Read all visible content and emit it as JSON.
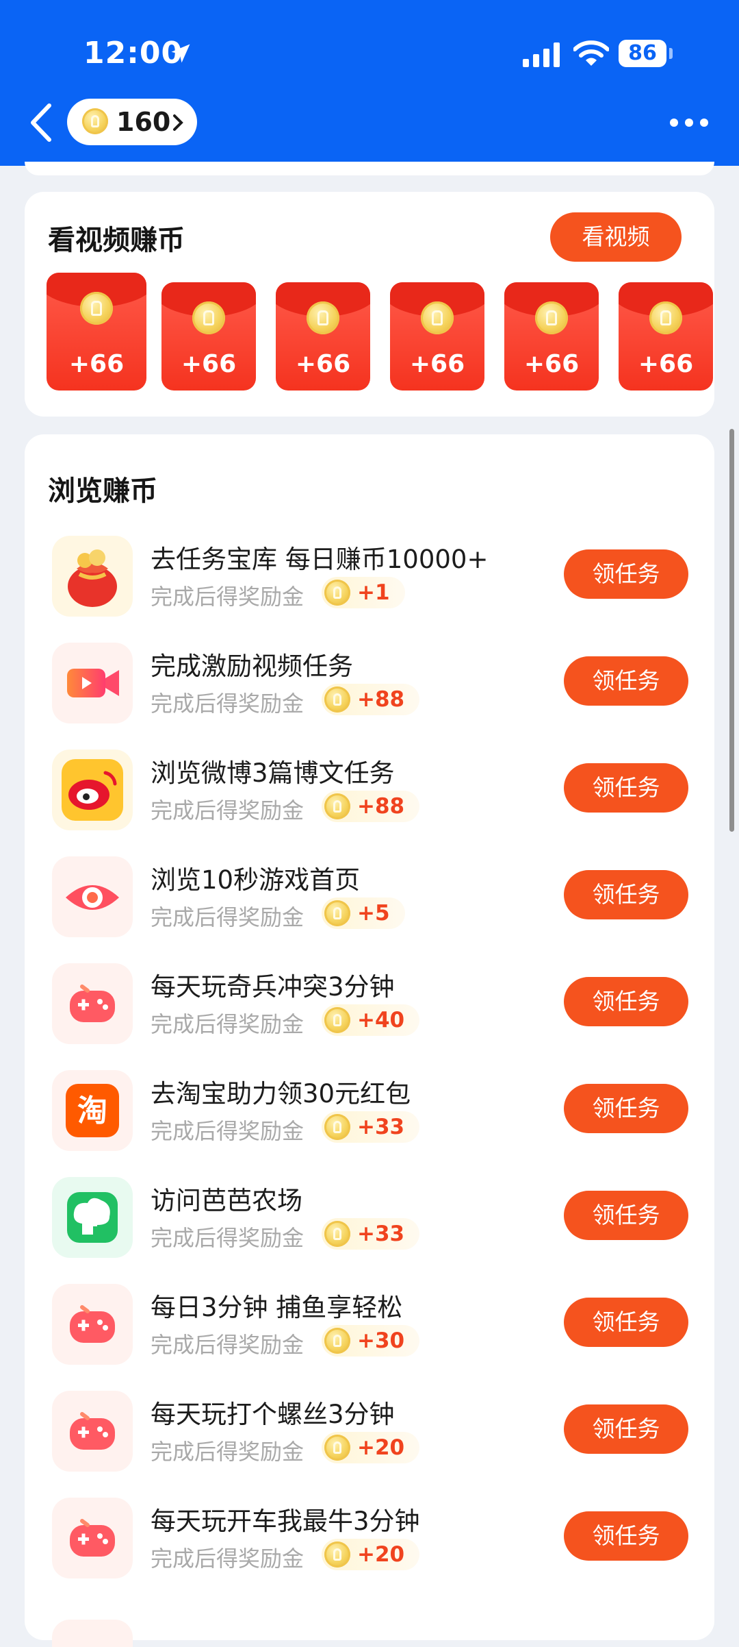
{
  "status_bar": {
    "time": "12:00",
    "battery": "86"
  },
  "header": {
    "coins": "160"
  },
  "video_section": {
    "title": "看视频赚币",
    "button": "看视频",
    "envelopes": [
      "+66",
      "+66",
      "+66",
      "+66",
      "+66",
      "+66"
    ]
  },
  "browse_section": {
    "title": "浏览赚币",
    "button_label": "领任务",
    "tasks": [
      {
        "title": "去任务宝库 每日赚币10000+",
        "sub": "完成后得奖励金",
        "reward": "+1",
        "icon": "lucky-bag-icon"
      },
      {
        "title": "完成激励视频任务",
        "sub": "完成后得奖励金",
        "reward": "+88",
        "icon": "video-camera-icon"
      },
      {
        "title": "浏览微博3篇博文任务",
        "sub": "完成后得奖励金",
        "reward": "+88",
        "icon": "weibo-icon"
      },
      {
        "title": "浏览10秒游戏首页",
        "sub": "完成后得奖励金",
        "reward": "+5",
        "icon": "eye-icon"
      },
      {
        "title": "每天玩奇兵冲突3分钟",
        "sub": "完成后得奖励金",
        "reward": "+40",
        "icon": "gamepad-icon"
      },
      {
        "title": "去淘宝助力领30元红包",
        "sub": "完成后得奖励金",
        "reward": "+33",
        "icon": "taobao-icon"
      },
      {
        "title": "访问芭芭农场",
        "sub": "完成后得奖励金",
        "reward": "+33",
        "icon": "farm-icon"
      },
      {
        "title": "每日3分钟 捕鱼享轻松",
        "sub": "完成后得奖励金",
        "reward": "+30",
        "icon": "gamepad-icon"
      },
      {
        "title": "每天玩打个螺丝3分钟",
        "sub": "完成后得奖励金",
        "reward": "+20",
        "icon": "gamepad-icon"
      },
      {
        "title": "每天玩开车我最牛3分钟",
        "sub": "完成后得奖励金",
        "reward": "+20",
        "icon": "gamepad-icon"
      }
    ]
  }
}
